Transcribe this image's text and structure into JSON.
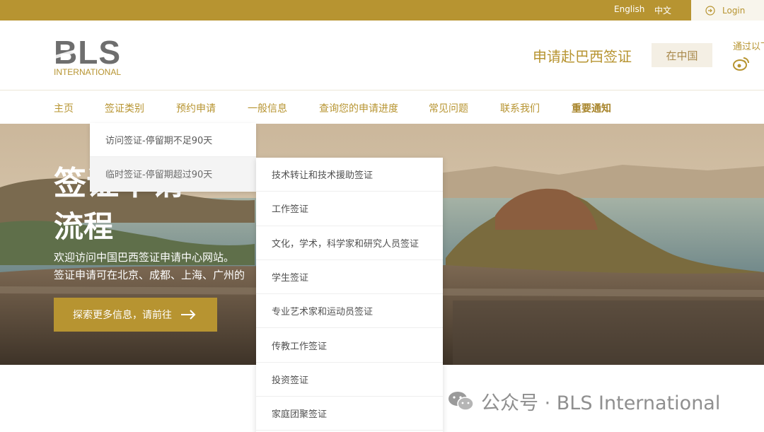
{
  "topbar": {
    "lang_en": "English",
    "lang_zh": "中文",
    "login_label": "Login"
  },
  "header": {
    "logo_text": "BLS",
    "logo_sub": "INTERNATIONAL",
    "title": "申请赴巴西签证",
    "country_button": "在中国",
    "follow_text": "通过以下"
  },
  "nav": {
    "items": [
      "主页",
      "签证类别",
      "预约申请",
      "一般信息",
      "查询您的申请进度",
      "常见问题",
      "联系我们",
      "重要通知"
    ]
  },
  "hero": {
    "title_line1": "签证申请",
    "title_line2": "流程",
    "desc_line1": "欢迎访问中国巴西签证申请中心网站。",
    "desc_line2": "签证申请可在北京、成都、上海、广州的",
    "button_label": "探索更多信息，请前往"
  },
  "visa_menu": {
    "items": [
      "访问签证-停留期不足90天",
      "临时签证-停留期超过90天"
    ]
  },
  "temp_visa_submenu": {
    "items": [
      "技术转让和技术援助签证",
      "工作签证",
      "文化，学术，科学家和研究人员签证",
      "学生签证",
      "专业艺术家和运动员签证",
      "传教工作签证",
      "投资签证",
      "家庭团聚签证"
    ]
  },
  "watermark": {
    "text": "公众号 · BLS International"
  },
  "colors": {
    "brand_gold": "#b79431",
    "topbar": "#b79431",
    "text_dark": "#505050"
  }
}
